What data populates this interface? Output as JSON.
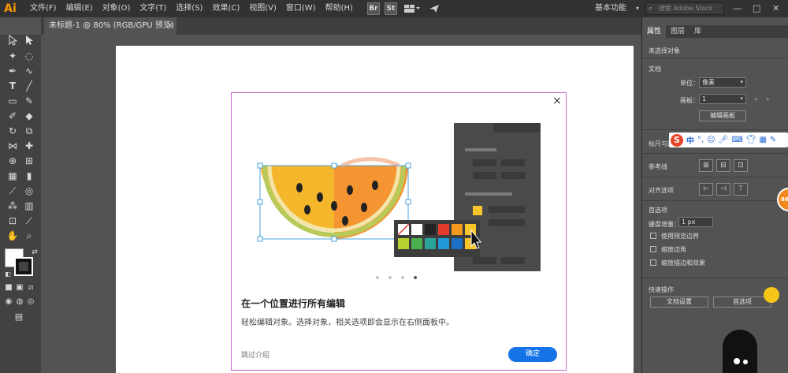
{
  "app": {
    "logo": "Ai"
  },
  "menu": [
    "文件(F)",
    "编辑(E)",
    "对象(O)",
    "文字(T)",
    "选择(S)",
    "效果(C)",
    "视图(V)",
    "窗口(W)",
    "帮助(H)"
  ],
  "menubar_buttons": {
    "bridge": "Br",
    "stock": "St"
  },
  "workspace": "基本功能",
  "stock_search_placeholder": "搜索 Adobe Stock",
  "document_tab": {
    "title": "未标题-1 @ 80% (RGB/GPU 预览)",
    "close": "×"
  },
  "dialog": {
    "title": "在一个位置进行所有编辑",
    "description": "轻松编辑对象。选择对象，相关选项即会显示在右侧面板中。",
    "skip": "跳过介绍",
    "ok": "确定",
    "close": "×",
    "page_count": 4,
    "active_page": 4,
    "swatch_colors_row1": [
      "#ffffff",
      "#ffffff",
      "#222222",
      "#e23b2e",
      "#f39a1e",
      "#f8c52b"
    ],
    "swatch_colors_row2": [
      "#b8d32f",
      "#4caf50",
      "#2aa39b",
      "#1f9ad6",
      "#1b6fc4",
      "#f8c52b"
    ]
  },
  "right_panel": {
    "tabs": [
      "属性",
      "图层",
      "库"
    ],
    "no_selection": "未选择对象",
    "document_section": "文档",
    "unit_label": "单位：",
    "unit_value": "像素",
    "artboard_label": "画板：",
    "artboard_value": "1",
    "edit_artboard_button": "编辑画板",
    "rulers_grid": "标尺与网格",
    "guides": "参考线",
    "align_options": "对齐选项",
    "preferences": "首选项",
    "keyboard_increment_label": "键盘增量：",
    "keyboard_increment_value": "1 px",
    "checkboxes": [
      "使用预览边界",
      "缩放边角",
      "缩放描边和效果"
    ],
    "quick_actions": "快速操作",
    "document_settings_button": "文档设置",
    "preferences_button": "首选项"
  },
  "sogou": {
    "logo": "S",
    "mode": "中"
  },
  "badge": "86",
  "colors": {
    "accent": "#1473e6",
    "dialog_border": "#c46bc6",
    "logo": "#ff9a00"
  }
}
